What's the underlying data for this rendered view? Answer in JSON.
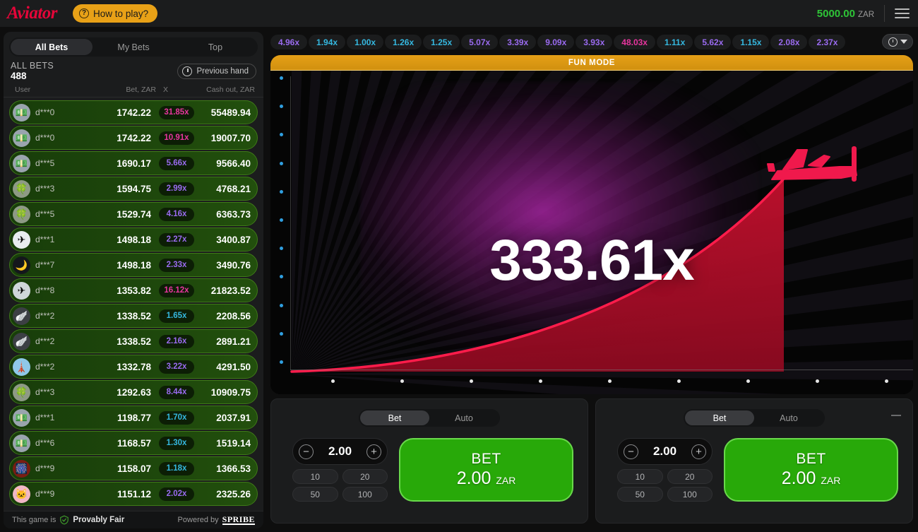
{
  "header": {
    "logo": "Aviator",
    "how_to_play": "How to play?",
    "balance": "5000.00",
    "currency": "ZAR"
  },
  "sidebar": {
    "tabs": [
      {
        "label": "All Bets",
        "active": true
      },
      {
        "label": "My Bets",
        "active": false
      },
      {
        "label": "Top",
        "active": false
      }
    ],
    "all_bets_label": "ALL BETS",
    "all_bets_count": "488",
    "previous_hand": "Previous hand",
    "columns": {
      "user": "User",
      "bet": "Bet, ZAR",
      "x": "X",
      "cashout": "Cash out, ZAR"
    },
    "rows": [
      {
        "avatar": "💵",
        "avatar_bg": "#9aa4ae",
        "user": "d***0",
        "bet": "1742.22",
        "mult": "31.85x",
        "mult_color": "#e8359f",
        "cashout": "55489.94"
      },
      {
        "avatar": "💵",
        "avatar_bg": "#9aa4ae",
        "user": "d***0",
        "bet": "1742.22",
        "mult": "10.91x",
        "mult_color": "#e8359f",
        "cashout": "19007.70"
      },
      {
        "avatar": "💵",
        "avatar_bg": "#9aa4ae",
        "user": "d***5",
        "bet": "1690.17",
        "mult": "5.66x",
        "mult_color": "#9a6bf0",
        "cashout": "9566.40"
      },
      {
        "avatar": "🍀",
        "avatar_bg": "#8e9a85",
        "user": "d***3",
        "bet": "1594.75",
        "mult": "2.99x",
        "mult_color": "#9a6bf0",
        "cashout": "4768.21"
      },
      {
        "avatar": "🍀",
        "avatar_bg": "#8e9a85",
        "user": "d***5",
        "bet": "1529.74",
        "mult": "4.16x",
        "mult_color": "#9a6bf0",
        "cashout": "6363.73"
      },
      {
        "avatar": "✈",
        "avatar_bg": "#e8ecef",
        "user": "d***1",
        "bet": "1498.18",
        "mult": "2.27x",
        "mult_color": "#9a6bf0",
        "cashout": "3400.87"
      },
      {
        "avatar": "🌙",
        "avatar_bg": "#14171c",
        "user": "d***7",
        "bet": "1498.18",
        "mult": "2.33x",
        "mult_color": "#9a6bf0",
        "cashout": "3490.76"
      },
      {
        "avatar": "✈",
        "avatar_bg": "#cfd6da",
        "user": "d***8",
        "bet": "1353.82",
        "mult": "16.12x",
        "mult_color": "#e8359f",
        "cashout": "21823.52"
      },
      {
        "avatar": "🪽",
        "avatar_bg": "#3c3f44",
        "user": "d***2",
        "bet": "1338.52",
        "mult": "1.65x",
        "mult_color": "#35b8e0",
        "cashout": "2208.56"
      },
      {
        "avatar": "🪽",
        "avatar_bg": "#3c3f44",
        "user": "d***2",
        "bet": "1338.52",
        "mult": "2.16x",
        "mult_color": "#9a6bf0",
        "cashout": "2891.21"
      },
      {
        "avatar": "🗼",
        "avatar_bg": "#8fc8e8",
        "user": "d***2",
        "bet": "1332.78",
        "mult": "3.22x",
        "mult_color": "#9a6bf0",
        "cashout": "4291.50"
      },
      {
        "avatar": "🍀",
        "avatar_bg": "#8e9a85",
        "user": "d***3",
        "bet": "1292.63",
        "mult": "8.44x",
        "mult_color": "#9a6bf0",
        "cashout": "10909.75"
      },
      {
        "avatar": "💵",
        "avatar_bg": "#9aa4ae",
        "user": "d***1",
        "bet": "1198.77",
        "mult": "1.70x",
        "mult_color": "#35b8e0",
        "cashout": "2037.91"
      },
      {
        "avatar": "💵",
        "avatar_bg": "#9aa4ae",
        "user": "d***6",
        "bet": "1168.57",
        "mult": "1.30x",
        "mult_color": "#35b8e0",
        "cashout": "1519.14"
      },
      {
        "avatar": "🎆",
        "avatar_bg": "#7a1d14",
        "user": "d***9",
        "bet": "1158.07",
        "mult": "1.18x",
        "mult_color": "#35b8e0",
        "cashout": "1366.53"
      },
      {
        "avatar": "🐱",
        "avatar_bg": "#f2b8c6",
        "user": "d***9",
        "bet": "1151.12",
        "mult": "2.02x",
        "mult_color": "#9a6bf0",
        "cashout": "2325.26"
      }
    ],
    "footer": {
      "this_game_is": "This game is",
      "provably_fair": "Provably Fair",
      "powered_by": "Powered by",
      "brand": "SPRIBE"
    }
  },
  "history": {
    "items": [
      {
        "value": "4.96x",
        "color": "#9a6bf0"
      },
      {
        "value": "1.94x",
        "color": "#35b8e0"
      },
      {
        "value": "1.00x",
        "color": "#35b8e0"
      },
      {
        "value": "1.26x",
        "color": "#35b8e0"
      },
      {
        "value": "1.25x",
        "color": "#35b8e0"
      },
      {
        "value": "5.07x",
        "color": "#9a6bf0"
      },
      {
        "value": "3.39x",
        "color": "#9a6bf0"
      },
      {
        "value": "9.09x",
        "color": "#9a6bf0"
      },
      {
        "value": "3.93x",
        "color": "#9a6bf0"
      },
      {
        "value": "48.03x",
        "color": "#e8359f"
      },
      {
        "value": "1.11x",
        "color": "#35b8e0"
      },
      {
        "value": "5.62x",
        "color": "#9a6bf0"
      },
      {
        "value": "1.15x",
        "color": "#35b8e0"
      },
      {
        "value": "2.08x",
        "color": "#9a6bf0"
      },
      {
        "value": "2.37x",
        "color": "#9a6bf0"
      }
    ]
  },
  "game": {
    "fun_mode": "FUN MODE",
    "multiplier": "333.61x",
    "curve_color": "#ff1c4b",
    "fill_color": "#a50d26",
    "glow_color": "#a3249e"
  },
  "bet_panels": [
    {
      "tabs": [
        {
          "label": "Bet",
          "active": true
        },
        {
          "label": "Auto",
          "active": false
        }
      ],
      "stake": "2.00",
      "minus": "−",
      "plus": "+",
      "quick": [
        "10",
        "20",
        "50",
        "100"
      ],
      "bet_label": "BET",
      "bet_amount": "2.00",
      "currency": "ZAR",
      "has_collapse": false
    },
    {
      "tabs": [
        {
          "label": "Bet",
          "active": true
        },
        {
          "label": "Auto",
          "active": false
        }
      ],
      "stake": "2.00",
      "minus": "−",
      "plus": "+",
      "quick": [
        "10",
        "20",
        "50",
        "100"
      ],
      "bet_label": "BET",
      "bet_amount": "2.00",
      "currency": "ZAR",
      "has_collapse": true
    }
  ]
}
